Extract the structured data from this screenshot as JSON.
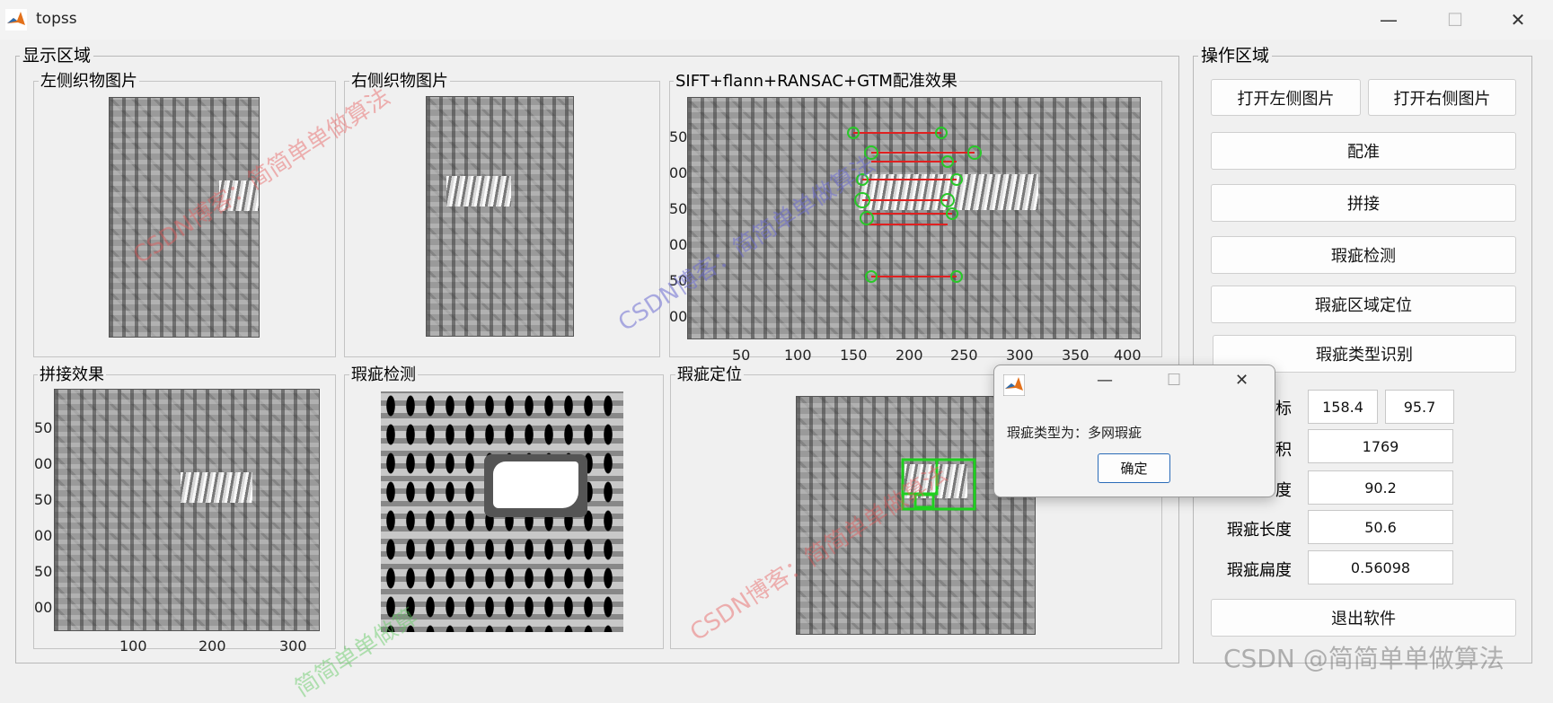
{
  "window": {
    "title": "topss",
    "minimize": "—",
    "maximize": "☐",
    "close": "✕"
  },
  "display_area": {
    "label": "显示区域",
    "panels": {
      "left_image": "左侧织物图片",
      "right_image": "右侧织物图片",
      "registration": "SIFT+flann+RANSAC+GTM配准效果",
      "stitch": "拼接效果",
      "defect_detect": "瑕疵检测",
      "defect_locate": "瑕疵定位"
    },
    "registration_axes": {
      "x_ticks": [
        "50",
        "100",
        "150",
        "200",
        "250",
        "300",
        "350",
        "400"
      ],
      "y_ticks": [
        "50",
        "00",
        "50",
        "00",
        "50",
        "00"
      ]
    },
    "stitch_axes": {
      "x_ticks": [
        "100",
        "200",
        "300"
      ],
      "y_ticks": [
        "50",
        "00",
        "50",
        "00",
        "50",
        "00"
      ]
    }
  },
  "operation_area": {
    "label": "操作区域",
    "buttons": {
      "open_left": "打开左侧图片",
      "open_right": "打开右侧图片",
      "register": "配准",
      "stitch": "拼接",
      "detect": "瑕疵检测",
      "locate": "瑕疵区域定位",
      "classify": "瑕疵类型识别",
      "exit": "退出软件"
    },
    "fields": {
      "coord_label": "标",
      "coord_x": "158.4",
      "coord_y": "95.7",
      "area_label": "积",
      "area": "1769",
      "third_label": "度",
      "third": "90.2",
      "length_label": "瑕疵长度",
      "length": "50.6",
      "flatness_label": "瑕疵扁度",
      "flatness": "0.56098"
    }
  },
  "dialog": {
    "message": "瑕疵类型为：多网瑕疵",
    "ok": "确定",
    "minimize": "—",
    "maximize": "☐",
    "close": "✕"
  },
  "watermarks": {
    "a": "CSDN博客：简简单单做算法",
    "b": "CSDN博客：简简单单做算法",
    "c": "CSDN博客：简简单单做算法",
    "d": "简简单单做算",
    "footer": "CSDN @简简单单做算法"
  },
  "colors": {
    "match_line": "#e02020",
    "match_circle": "#29c829",
    "bbox": "#1fd01f"
  }
}
